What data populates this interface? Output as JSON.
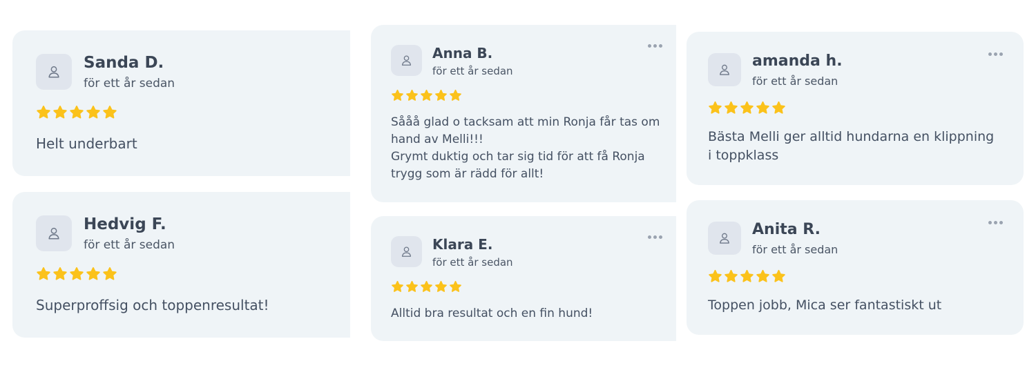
{
  "colors": {
    "card_background": "#eff4f7",
    "star": "#fbc21b",
    "avatar_background": "#e0e5ed"
  },
  "rating_max": 5,
  "reviews": [
    {
      "name": "Sanda D.",
      "time": "för ett år sedan",
      "rating": 5,
      "text": "Helt underbart"
    },
    {
      "name": "Hedvig F.",
      "time": "för ett år sedan",
      "rating": 5,
      "text": "Superproffsig och toppenresultat!"
    },
    {
      "name": "Anna B.",
      "time": "för ett år sedan",
      "rating": 5,
      "text": "Sååå glad o tacksam att min Ronja får tas om hand av Melli!!!\nGrymt duktig och tar sig tid för att få Ronja trygg som är rädd för allt!"
    },
    {
      "name": "Klara E.",
      "time": "för ett år sedan",
      "rating": 5,
      "text": "Alltid bra resultat och en fin hund!"
    },
    {
      "name": "amanda h.",
      "time": "för ett år sedan",
      "rating": 5,
      "text": "Bästa Melli ger alltid hundarna en klippning i toppklass"
    },
    {
      "name": "Anita R.",
      "time": "för ett år sedan",
      "rating": 5,
      "text": "Toppen jobb, Mica ser fantastiskt  ut"
    }
  ]
}
